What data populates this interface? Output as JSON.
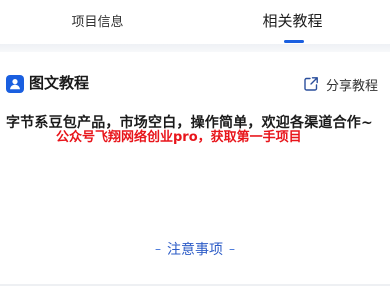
{
  "tabs": {
    "info_label": "项目信息",
    "tutorial_label": "相关教程",
    "active_tab": "相关教程"
  },
  "section": {
    "title": "图文教程",
    "share_label": "分享教程"
  },
  "content": {
    "body": "字节系豆包产品，市场空白，操作简单，欢迎各渠道合作~",
    "watermark": "公众号飞翔网络创业pro，获取第一手项目"
  },
  "notice": {
    "dash_left": "–",
    "label": "注意事项",
    "dash_right": "–"
  },
  "colors": {
    "accent": "#1a5fe0",
    "watermark": "#e8151b",
    "notice_text": "#2d5cc7"
  },
  "icons": {
    "section_icon": "document-person-icon",
    "share_icon": "share-icon"
  }
}
